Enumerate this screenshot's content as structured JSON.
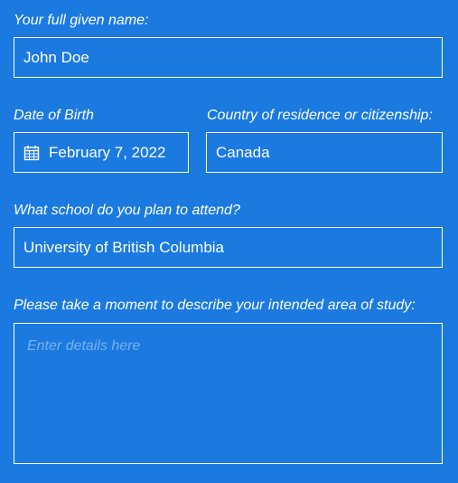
{
  "form": {
    "name": {
      "label": "Your full given name:",
      "value": "John Doe"
    },
    "dob": {
      "label": "Date of Birth",
      "value": "February 7, 2022",
      "icon": "calendar-icon"
    },
    "country": {
      "label": "Country of residence or citizenship:",
      "value": "Canada"
    },
    "school": {
      "label": "What school do you plan to attend?",
      "value": "University of British Columbia"
    },
    "study": {
      "label": "Please take a moment to describe your intended area of study:",
      "placeholder": "Enter details here",
      "value": ""
    }
  },
  "colors": {
    "background": "#1b7ae0",
    "field_border": "#ffffff",
    "text": "#ffffff",
    "placeholder": "#79b0ec"
  }
}
